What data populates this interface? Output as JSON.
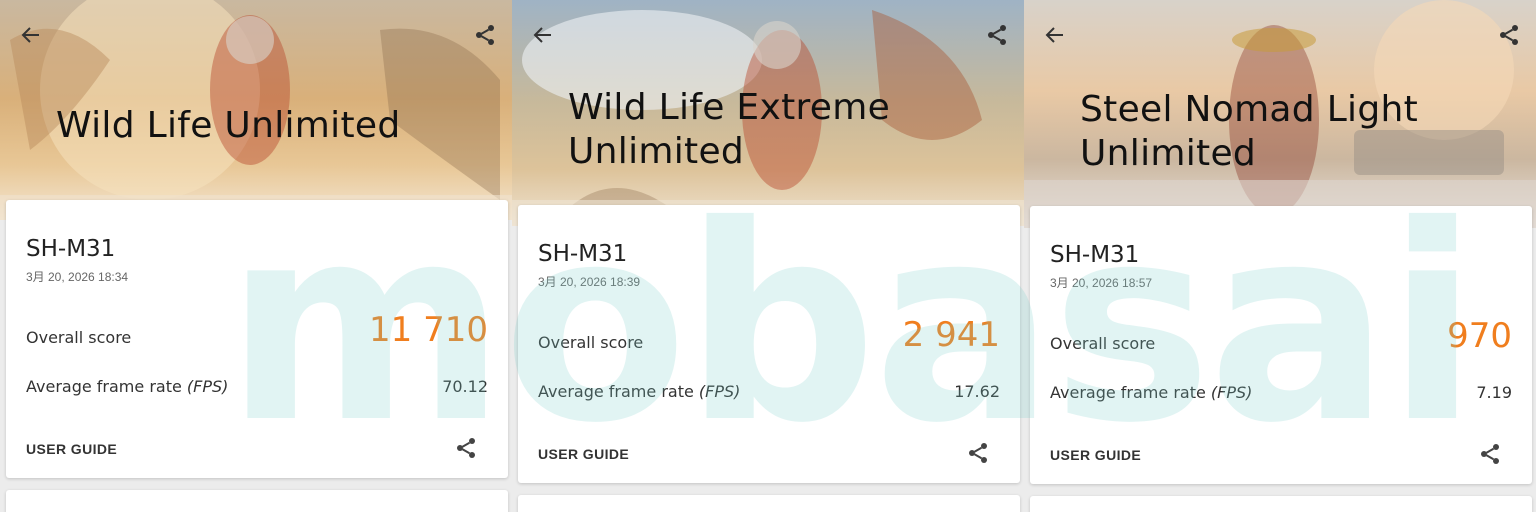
{
  "panels": [
    {
      "title": "Wild Life Unlimited",
      "device": "SH-M31",
      "date": "3月 20, 2026 18:34",
      "overall_label": "Overall score",
      "overall_score": "11 710",
      "fps_label": "Average frame rate ",
      "fps_unit": "(FPS)",
      "fps_value": "70.12",
      "guide_label": "USER GUIDE"
    },
    {
      "title": "Wild Life Extreme Unlimited",
      "device": "SH-M31",
      "date": "3月 20, 2026 18:39",
      "overall_label": "Overall score",
      "overall_score": "2 941",
      "fps_label": "Average frame rate ",
      "fps_unit": "(FPS)",
      "fps_value": "17.62",
      "guide_label": "USER GUIDE"
    },
    {
      "title": "Steel Nomad Light Unlimited",
      "device": "SH-M31",
      "date": "3月 20, 2026 18:57",
      "overall_label": "Overall score",
      "overall_score": "970",
      "fps_label": "Average frame rate ",
      "fps_unit": "(FPS)",
      "fps_value": "7.19",
      "guide_label": "USER GUIDE"
    }
  ],
  "watermark": "mobasai",
  "icons": {
    "back": "arrow-left-icon",
    "share": "share-icon"
  },
  "colors": {
    "score": "#f07e1e",
    "watermark": "#78cdc8"
  }
}
